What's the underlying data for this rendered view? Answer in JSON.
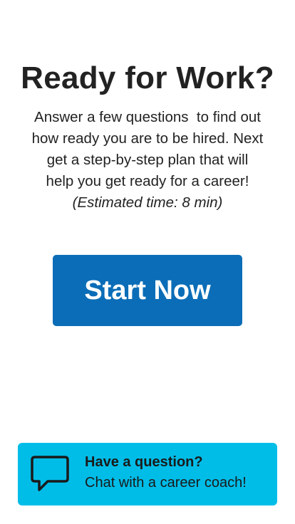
{
  "header": {
    "title": "Ready for Work?"
  },
  "intro": {
    "line1": "Answer a few questions  to find out",
    "line2": "how ready you are to be hired. Next",
    "line3": "get a step-by-step plan that will",
    "line4": "help you get ready for a career!",
    "estimate": "(Estimated time: 8 min)"
  },
  "start_button": {
    "label": "Start Now"
  },
  "chat_card": {
    "heading": "Have a question?",
    "subtext": "Chat with a career coach!",
    "icon": "chat-bubble-icon"
  },
  "colors": {
    "primary_button": "#0b6db7",
    "chat_card": "#00bde8",
    "text": "#222222"
  }
}
